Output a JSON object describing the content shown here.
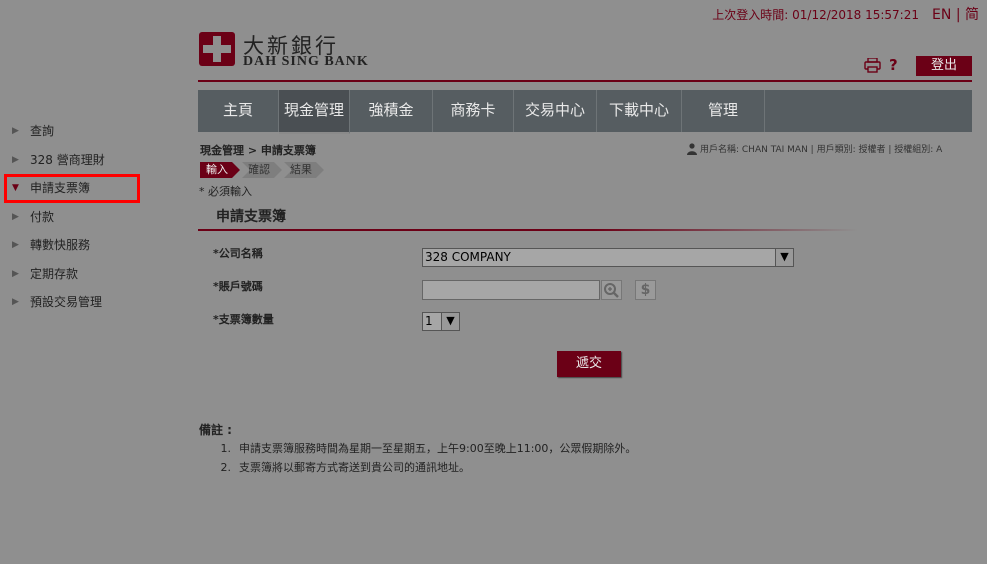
{
  "header": {
    "last_login_label": "上次登入時間:",
    "last_login_time": "01/12/2018 15:57:21",
    "lang_en": "EN",
    "lang_sep": "|",
    "lang_sc": "简",
    "logo_cn": "大新銀行",
    "logo_en": "DAH SING BANK",
    "help": "?",
    "logout_label": "登出"
  },
  "nav": {
    "items": [
      {
        "label": "主頁"
      },
      {
        "label": "現金管理"
      },
      {
        "label": "強積金"
      },
      {
        "label": "商務卡"
      },
      {
        "label": "交易中心"
      },
      {
        "label": "下載中心"
      },
      {
        "label": "管理"
      }
    ]
  },
  "sidebar": {
    "items": [
      {
        "label": "查詢"
      },
      {
        "label": "328 營商理財"
      },
      {
        "label": "申請支票簿"
      },
      {
        "label": "付款"
      },
      {
        "label": "轉數快服務"
      },
      {
        "label": "定期存款"
      },
      {
        "label": "預設交易管理"
      }
    ]
  },
  "breadcrumb": "現金管理 > 申請支票簿",
  "user_info": "用戶名稱: CHAN TAI MAN | 用戶類別: 授權者 | 授權組別: A",
  "steps": [
    {
      "label": "輸入"
    },
    {
      "label": "確認"
    },
    {
      "label": "結果"
    }
  ],
  "required_note": "* 必須輸入",
  "form": {
    "title": "申請支票簿",
    "company_label": "*公司名稱",
    "company_value": "328 COMPANY",
    "account_label": "*賬戶號碼",
    "account_value": "",
    "qty_label": "*支票簿數量",
    "qty_value": "1",
    "dollar_symbol": "$",
    "submit_label": "遞交"
  },
  "notes": {
    "title": "備註 :",
    "items": [
      {
        "num": "1.",
        "text": "申請支票簿服務時間為星期一至星期五，上午9:00至晚上11:00，公眾假期除外。"
      },
      {
        "num": "2.",
        "text": "支票簿將以郵寄方式寄送到貴公司的通訊地址。"
      }
    ]
  }
}
